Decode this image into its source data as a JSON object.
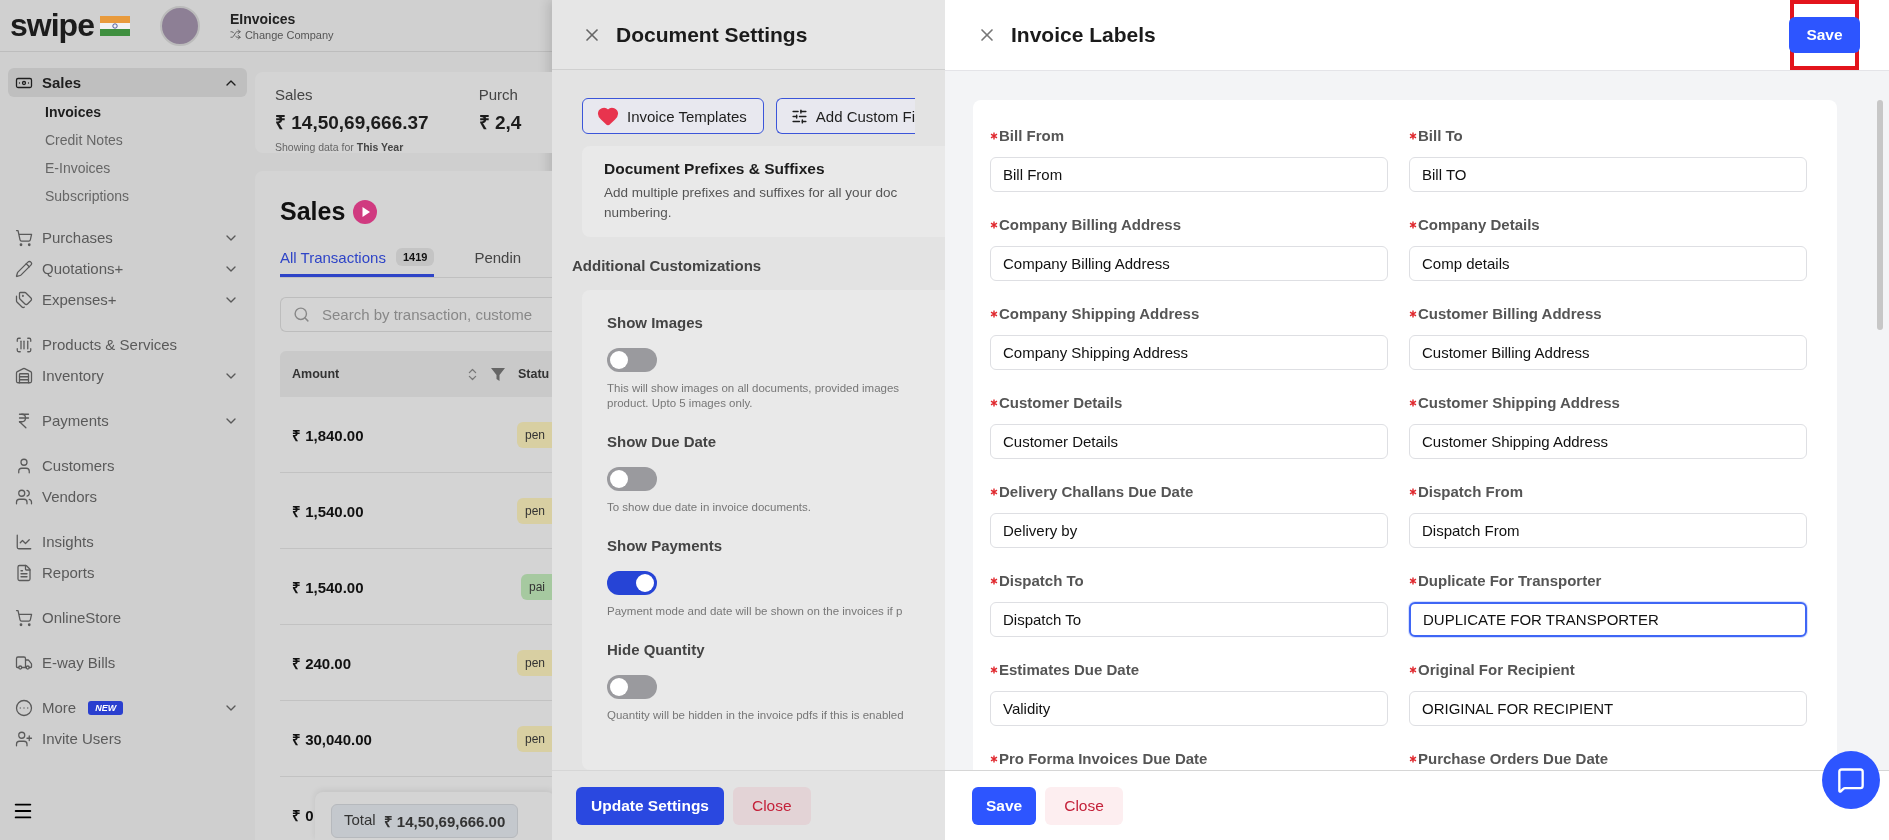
{
  "app": {
    "brand": "swipe",
    "company": {
      "name": "EInvoices",
      "switch_label": "Change Company"
    }
  },
  "sidebar": {
    "sections": [
      [
        {
          "label": "Sales",
          "selected": true,
          "expanded": true,
          "children": [
            {
              "label": "Invoices",
              "selected": true
            },
            {
              "label": "Credit Notes",
              "selected": false
            },
            {
              "label": "E-Invoices",
              "selected": false
            },
            {
              "label": "Subscriptions",
              "selected": false
            }
          ]
        },
        {
          "label": "Purchases",
          "selected": false,
          "expanded": false
        },
        {
          "label": "Quotations+",
          "selected": false,
          "expanded": false
        },
        {
          "label": "Expenses+",
          "selected": false,
          "expanded": false
        }
      ],
      [
        {
          "label": "Products & Services",
          "selected": false
        },
        {
          "label": "Inventory",
          "selected": false,
          "expanded": false
        }
      ],
      [
        {
          "label": "Payments",
          "selected": false,
          "expanded": false
        }
      ],
      [
        {
          "label": "Customers",
          "selected": false
        },
        {
          "label": "Vendors",
          "selected": false
        }
      ],
      [
        {
          "label": "Insights",
          "selected": false
        },
        {
          "label": "Reports",
          "selected": false
        }
      ],
      [
        {
          "label": "OnlineStore",
          "selected": false
        }
      ],
      [
        {
          "label": "E-way Bills",
          "selected": false
        }
      ],
      [
        {
          "label": "More",
          "badge": "NEW",
          "selected": false,
          "expanded": false
        },
        {
          "label": "Invite Users",
          "selected": false
        }
      ]
    ]
  },
  "main": {
    "stats": [
      {
        "label": "Sales",
        "value": "₹ 14,50,69,666.37",
        "note": "Showing data for **This Year**"
      },
      {
        "label": "Purch",
        "value": "₹ 2,4"
      }
    ],
    "title": "Sales",
    "tabs": [
      {
        "label": "All Transactions",
        "count": "1419",
        "selected": true
      },
      {
        "label": "Pendin",
        "selected": false
      }
    ],
    "search": {
      "placeholder": "Search by transaction, custome"
    },
    "table": {
      "columns": [
        "Amount",
        "Statu"
      ],
      "rows": [
        {
          "amount": "₹ 1,840.00",
          "status": "pen",
          "color": "#d8cfa2"
        },
        {
          "amount": "₹ 1,540.00",
          "status": "pen",
          "color": "#d8cfa2"
        },
        {
          "amount": "₹ 1,540.00",
          "status": "pai",
          "color": "#a6c9a0"
        },
        {
          "amount": "₹ 240.00",
          "status": "pen",
          "color": "#d8cfa2"
        },
        {
          "amount": "₹ 30,040.00",
          "status": "pen",
          "color": "#d8cfa2"
        },
        {
          "amount": "₹ 0"
        }
      ]
    },
    "total": {
      "label": "Total",
      "value": "₹ 14,50,69,666.00"
    }
  },
  "document_settings": {
    "title": "Document Settings",
    "buttons": [
      "Invoice Templates",
      "Add Custom Fi"
    ],
    "prefix_card": {
      "title": "Document Prefixes & Suffixes",
      "lines": [
        "Add multiple prefixes and suffixes for all your doc",
        "numbering."
      ]
    },
    "section_title": "Additional Customizations",
    "toggles": [
      {
        "label": "Show Images",
        "on": false,
        "lines": [
          "This will show images on all documents, provided images",
          "product. Upto 5 images only."
        ]
      },
      {
        "label": "Show Due Date",
        "on": false,
        "lines": [
          "To show due date in invoice documents."
        ]
      },
      {
        "label": "Show Payments",
        "on": true,
        "lines": [
          "Payment mode and date will be shown on the invoices if p"
        ]
      },
      {
        "label": "Hide Quantity",
        "on": false,
        "lines": [
          "Quantity will be hidden in the invoice pdfs if this is enabled"
        ]
      }
    ],
    "footer": {
      "primary": "Update Settings",
      "secondary": "Close"
    }
  },
  "invoice_labels": {
    "title": "Invoice Labels",
    "save": "Save",
    "fields": [
      {
        "label": "Bill From",
        "value": "Bill From",
        "focused": false
      },
      {
        "label": "Bill To",
        "value": "Bill TO",
        "focused": false
      },
      {
        "label": "Company Billing Address",
        "value": "Company Billing Address",
        "focused": false
      },
      {
        "label": "Company Details",
        "value": "Comp details",
        "focused": false
      },
      {
        "label": "Company Shipping Address",
        "value": "Company Shipping Address",
        "focused": false
      },
      {
        "label": "Customer Billing Address",
        "value": "Customer Billing Address",
        "focused": false
      },
      {
        "label": "Customer Details",
        "value": "Customer Details",
        "focused": false
      },
      {
        "label": "Customer Shipping Address",
        "value": "Customer Shipping Address",
        "focused": false
      },
      {
        "label": "Delivery Challans Due Date",
        "value": "Delivery by",
        "focused": false
      },
      {
        "label": "Dispatch From",
        "value": "Dispatch From",
        "focused": false
      },
      {
        "label": "Dispatch To",
        "value": "Dispatch To",
        "focused": false
      },
      {
        "label": "Duplicate For Transporter",
        "value": "DUPLICATE FOR TRANSPORTER",
        "focused": true
      },
      {
        "label": "Estimates Due Date",
        "value": "Validity",
        "focused": false
      },
      {
        "label": "Original For Recipient",
        "value": "ORIGINAL FOR RECIPIENT",
        "focused": false
      },
      {
        "label": "Pro Forma Invoices Due Date"
      },
      {
        "label": "Purchase Orders Due Date"
      }
    ],
    "footer": {
      "primary": "Save",
      "secondary": "Close"
    }
  }
}
